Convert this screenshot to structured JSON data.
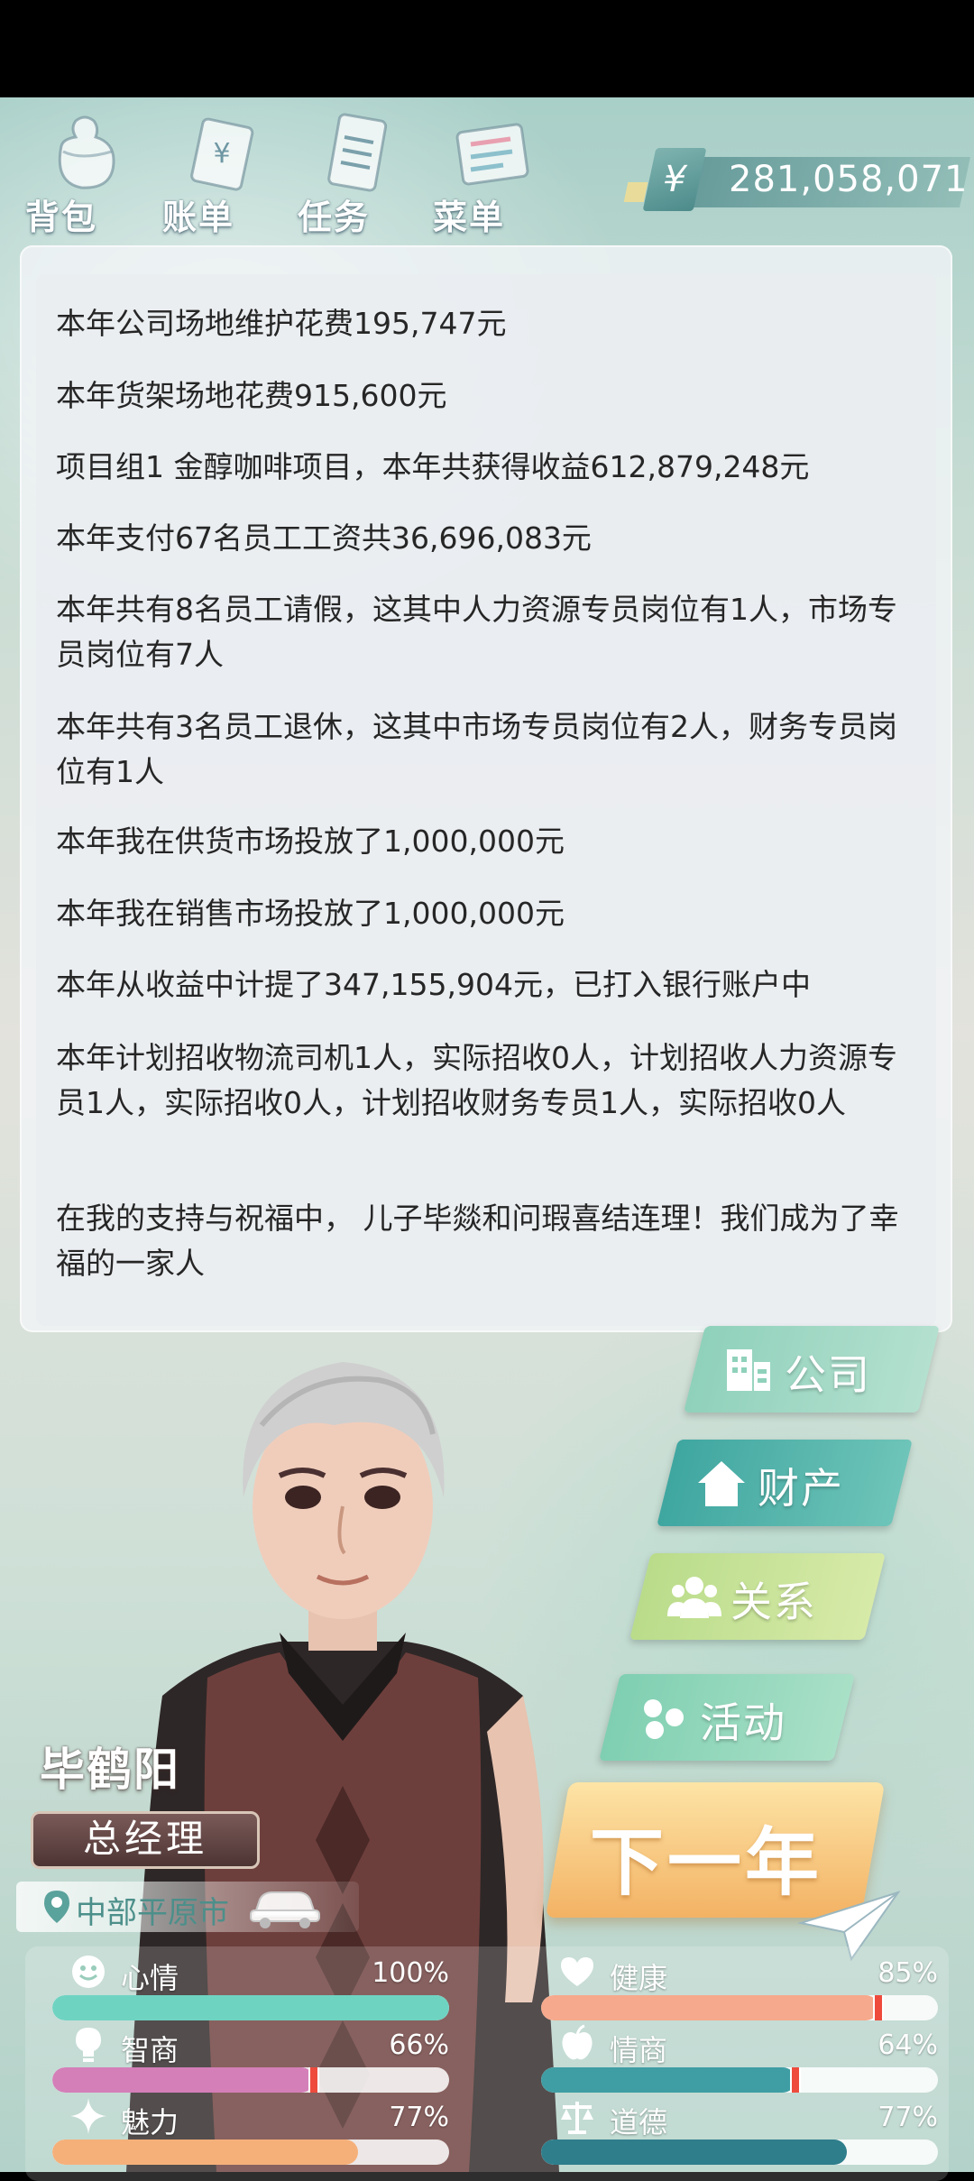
{
  "toolbar": {
    "bag": "背包",
    "ledger": "账单",
    "tasks": "任务",
    "menu": "菜单"
  },
  "money": {
    "symbol": "¥",
    "amount": "281,058,071"
  },
  "messages": [
    "本年公司场地维护花费195,747元",
    "本年货架场地花费915,600元",
    "项目组1 金醇咖啡项目，本年共获得收益612,879,248元",
    "本年支付67名员工工资共36,696,083元",
    "本年共有8名员工请假，这其中人力资源专员岗位有1人，市场专员岗位有7人",
    "本年共有3名员工退休，这其中市场专员岗位有2人，财务专员岗位有1人",
    "本年我在供货市场投放了1,000,000元",
    "本年我在销售市场投放了1,000,000元",
    "本年从收益中计提了347,155,904元，已打入银行账户中",
    "本年计划招收物流司机1人，实际招收0人，计划招收人力资源专员1人，实际招收0人，计划招收财务专员1人，实际招收0人",
    "在我的支持与祝福中， 儿子毕燚和问瑕喜结连理！我们成为了幸福的一家人"
  ],
  "menu": {
    "company": "公司",
    "property": "财产",
    "relations": "关系",
    "activity": "活动",
    "next_year": "下一年"
  },
  "player": {
    "name": "毕鹤阳",
    "title": "总经理",
    "location": "中部平原市"
  },
  "stats": {
    "mood": {
      "label": "心情",
      "percent": "100%",
      "value": 100
    },
    "health": {
      "label": "健康",
      "percent": "85%",
      "value": 85
    },
    "iq": {
      "label": "智商",
      "percent": "66%",
      "value": 66
    },
    "eq": {
      "label": "情商",
      "percent": "64%",
      "value": 64
    },
    "charm": {
      "label": "魅力",
      "percent": "77%",
      "value": 77
    },
    "morality": {
      "label": "道德",
      "percent": "77%",
      "value": 77
    }
  },
  "colors": {
    "mood": "#6fd3c2",
    "health": "#f6a98c",
    "iq": "#d47fb8",
    "eq": "#3f9ea3",
    "charm": "#f5b07a",
    "morality": "#2f7e8c"
  }
}
